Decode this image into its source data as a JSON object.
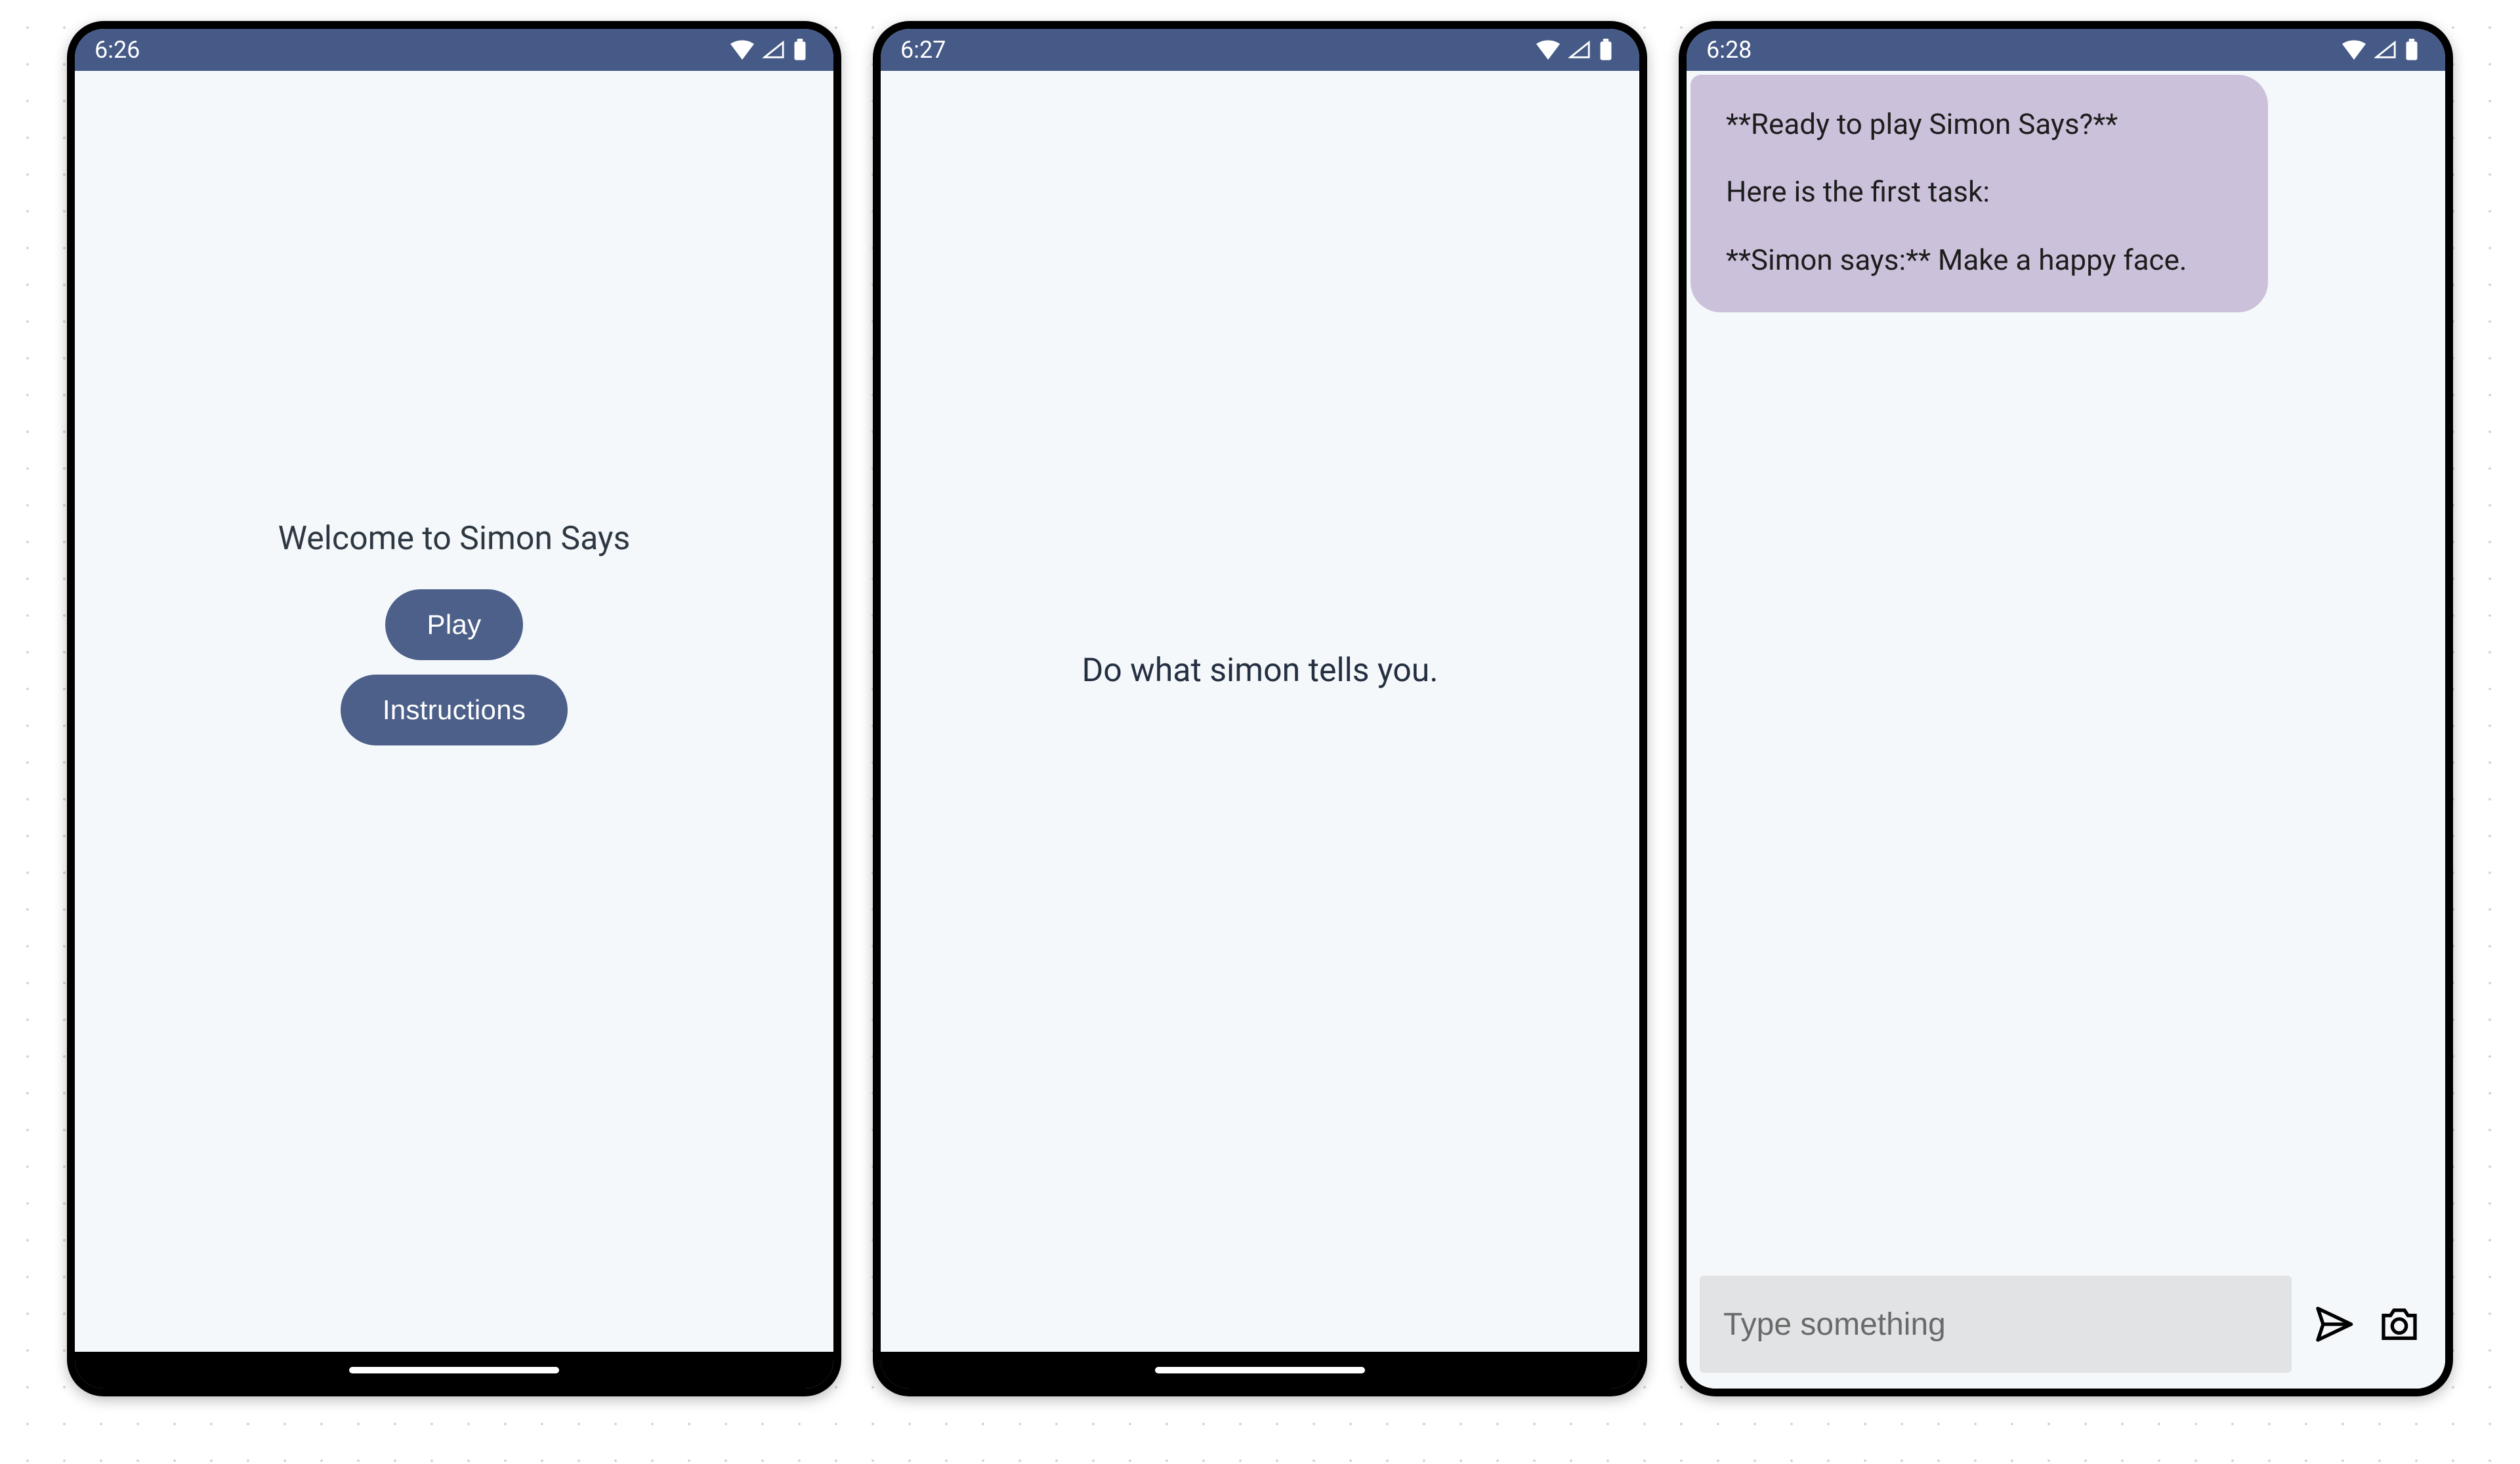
{
  "canvas": {
    "dot_color": "#d6d6d6"
  },
  "colors": {
    "status_bar": "#455a86",
    "button_bg": "#4c6089",
    "screen_bg": "#f5f8fb",
    "bubble_bg": "#ccc1db",
    "composer_bg": "#e1e3e5"
  },
  "phones": [
    {
      "time": "6:26",
      "status_icons": [
        "wifi-icon",
        "signal-icon",
        "battery-icon"
      ],
      "screen": "welcome",
      "welcome_title": "Welcome to Simon Says",
      "play_label": "Play",
      "instructions_label": "Instructions",
      "has_gesture_bar": true
    },
    {
      "time": "6:27",
      "status_icons": [
        "wifi-icon",
        "signal-icon",
        "battery-icon"
      ],
      "screen": "instructions",
      "instructions_text": "Do what simon tells you.",
      "has_gesture_bar": true
    },
    {
      "time": "6:28",
      "status_icons": [
        "wifi-icon",
        "signal-icon",
        "battery-icon"
      ],
      "screen": "chat",
      "bubble_lines": [
        "**Ready to play Simon Says?**",
        "Here is the first task:",
        "**Simon says:** Make a happy face."
      ],
      "composer_placeholder": "Type something",
      "send_icon": "send-icon",
      "camera_icon": "camera-icon",
      "has_gesture_bar": false
    }
  ]
}
